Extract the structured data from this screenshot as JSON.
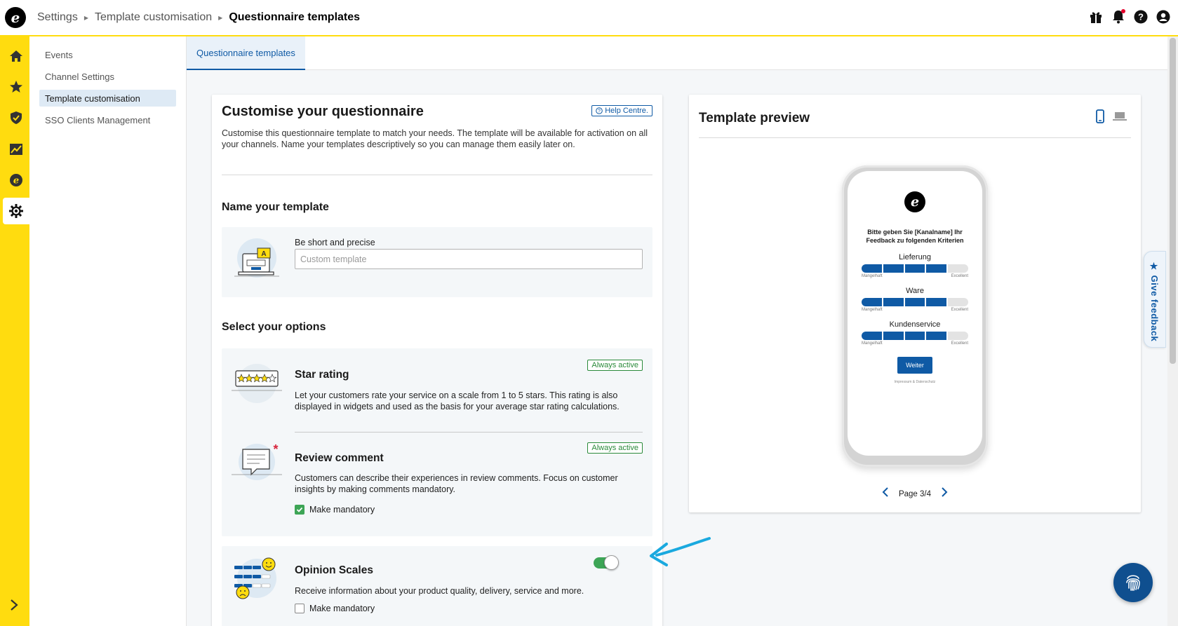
{
  "breadcrumb": {
    "items": [
      "Settings",
      "Template customisation"
    ],
    "current": "Questionnaire templates"
  },
  "subnav": {
    "items": [
      {
        "label": "Events"
      },
      {
        "label": "Channel Settings"
      },
      {
        "label": "Template customisation"
      },
      {
        "label": "SSO Clients Management"
      }
    ]
  },
  "tabs": [
    {
      "label": "Questionnaire templates"
    }
  ],
  "customise": {
    "title": "Customise your questionnaire",
    "help_label": "Help Centre.",
    "intro": "Customise this questionnaire template to match your needs. The template will be available for activation on all your channels. Name your templates descriptively so you can manage them easily later on."
  },
  "name_section": {
    "title": "Name your template",
    "field_label": "Be short and precise",
    "placeholder": "Custom template"
  },
  "options_section": {
    "title": "Select your options",
    "star_rating": {
      "title": "Star rating",
      "badge": "Always active",
      "description": "Let your customers rate your service on a scale from 1 to 5 stars. This rating is also displayed in widgets and used as the basis for your average star rating calculations."
    },
    "review_comment": {
      "title": "Review comment",
      "badge": "Always active",
      "description": "Customers can describe their experiences in review comments. Focus on customer insights by making comments mandatory.",
      "mandatory_label": "Make mandatory",
      "mandatory": true
    },
    "opinion_scales": {
      "title": "Opinion Scales",
      "description": "Receive information about your product quality, delivery, service and more.",
      "mandatory_label": "Make mandatory",
      "mandatory": false,
      "enabled": true
    }
  },
  "preview": {
    "title": "Template preview",
    "phone": {
      "heading": "Bitte geben Sie [Kanalname] Ihr Feedback zu folgenden Kriterien",
      "criteria": [
        {
          "label": "Lieferung",
          "filled": 4,
          "total": 5
        },
        {
          "label": "Ware",
          "filled": 4,
          "total": 5
        },
        {
          "label": "Kundenservice",
          "filled": 4,
          "total": 5
        }
      ],
      "scale_low": "Mangelhaft",
      "scale_high": "Excellent",
      "button": "Weiter",
      "footer": "Impressum & Datenschutz"
    },
    "pager": "Page 3/4"
  },
  "feedback_tab": {
    "label": "Give feedback"
  },
  "colors": {
    "brand_yellow": "#ffdc0f",
    "primary_blue": "#0f5aa5",
    "success_green": "#3da556",
    "annotation_arrow": "#1aa9df"
  }
}
